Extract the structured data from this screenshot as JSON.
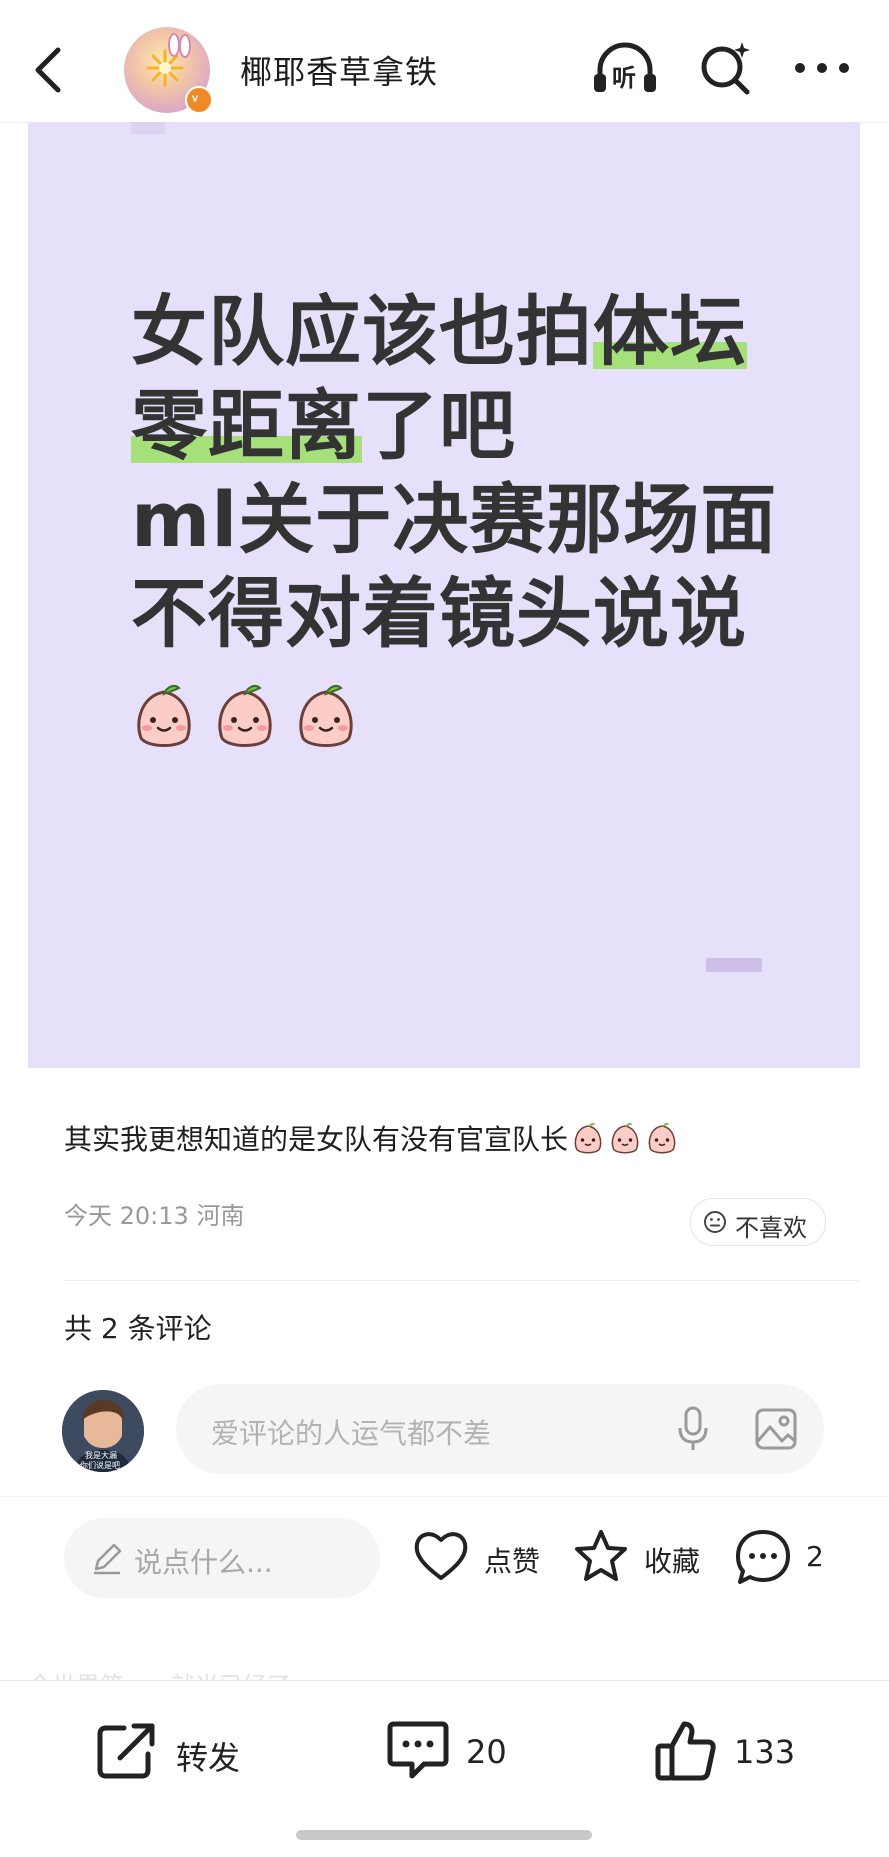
{
  "header": {
    "username": "椰耶香草拿铁",
    "listen_label": "听"
  },
  "post_image": {
    "lines": [
      {
        "plain": "女队应该也拍",
        "marked": "体坛"
      },
      {
        "marked": "零距离",
        "plain": "了吧"
      },
      {
        "plain": "ml关于决赛那场面"
      },
      {
        "plain": "不得对着镜头说说"
      }
    ]
  },
  "post": {
    "caption": "其实我更想知道的是女队有没有官宣队长",
    "time": "今天 20:13",
    "location": "河南",
    "dislike_label": "不喜欢"
  },
  "comments": {
    "count_label": "共 2 条评论",
    "input_placeholder": "爱评论的人运气都不差",
    "avatar_text": "我是大漏\n你们说是吧",
    "say_placeholder": "说点什么...",
    "like_label": "点赞",
    "collect_label": "收藏",
    "comment_count": "2"
  },
  "bottom_bar": {
    "faded_text": "今世界第一...就当已经了",
    "share_label": "转发",
    "comments_count": "20",
    "likes_count": "133"
  }
}
